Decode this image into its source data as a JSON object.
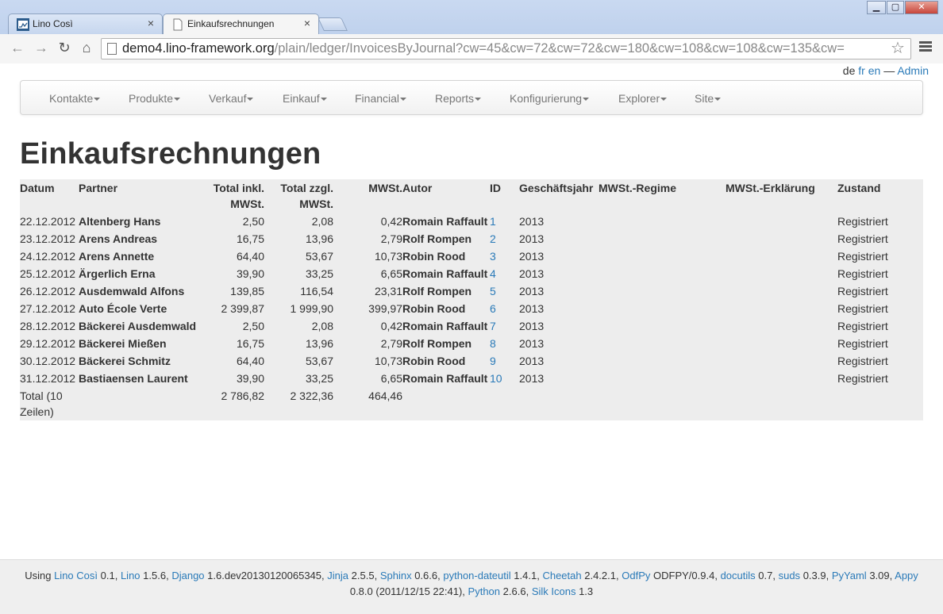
{
  "browser": {
    "tabs": [
      {
        "title": "Lino Così"
      },
      {
        "title": "Einkaufsrechnungen"
      }
    ],
    "url_host": "demo4.lino-framework.org",
    "url_path": "/plain/ledger/InvoicesByJournal?cw=45&cw=72&cw=72&cw=180&cw=108&cw=108&cw=135&cw="
  },
  "langbar": {
    "de": "de",
    "fr": "fr",
    "en": "en",
    "sep": "—",
    "admin": "Admin"
  },
  "nav": [
    "Kontakte",
    "Produkte",
    "Verkauf",
    "Einkauf",
    "Financial",
    "Reports",
    "Konfigurierung",
    "Explorer",
    "Site"
  ],
  "title": "Einkaufsrechnungen",
  "table": {
    "headers": {
      "datum": "Datum",
      "partner": "Partner",
      "total_incl": "Total inkl. MWSt.",
      "total_excl": "Total zzgl. MWSt.",
      "mwst": "MWSt.",
      "autor": "Autor",
      "id": "ID",
      "jahr": "Geschäftsjahr",
      "regime": "MWSt.-Regime",
      "erklaerung": "MWSt.-Erklärung",
      "zustand": "Zustand"
    },
    "rows": [
      {
        "datum": "22.12.2012",
        "partner": "Altenberg Hans",
        "incl": "2,50",
        "excl": "2,08",
        "mwst": "0,42",
        "autor": "Romain Raffault",
        "id": "1",
        "jahr": "2013",
        "zustand": "Registriert"
      },
      {
        "datum": "23.12.2012",
        "partner": "Arens Andreas",
        "incl": "16,75",
        "excl": "13,96",
        "mwst": "2,79",
        "autor": "Rolf Rompen",
        "id": "2",
        "jahr": "2013",
        "zustand": "Registriert"
      },
      {
        "datum": "24.12.2012",
        "partner": "Arens Annette",
        "incl": "64,40",
        "excl": "53,67",
        "mwst": "10,73",
        "autor": "Robin Rood",
        "id": "3",
        "jahr": "2013",
        "zustand": "Registriert"
      },
      {
        "datum": "25.12.2012",
        "partner": "Ärgerlich Erna",
        "incl": "39,90",
        "excl": "33,25",
        "mwst": "6,65",
        "autor": "Romain Raffault",
        "id": "4",
        "jahr": "2013",
        "zustand": "Registriert"
      },
      {
        "datum": "26.12.2012",
        "partner": "Ausdemwald Alfons",
        "incl": "139,85",
        "excl": "116,54",
        "mwst": "23,31",
        "autor": "Rolf Rompen",
        "id": "5",
        "jahr": "2013",
        "zustand": "Registriert"
      },
      {
        "datum": "27.12.2012",
        "partner": "Auto École Verte",
        "incl": "2 399,87",
        "excl": "1 999,90",
        "mwst": "399,97",
        "autor": "Robin Rood",
        "id": "6",
        "jahr": "2013",
        "zustand": "Registriert"
      },
      {
        "datum": "28.12.2012",
        "partner": "Bäckerei Ausdemwald",
        "incl": "2,50",
        "excl": "2,08",
        "mwst": "0,42",
        "autor": "Romain Raffault",
        "id": "7",
        "jahr": "2013",
        "zustand": "Registriert"
      },
      {
        "datum": "29.12.2012",
        "partner": "Bäckerei Mießen",
        "incl": "16,75",
        "excl": "13,96",
        "mwst": "2,79",
        "autor": "Rolf Rompen",
        "id": "8",
        "jahr": "2013",
        "zustand": "Registriert"
      },
      {
        "datum": "30.12.2012",
        "partner": "Bäckerei Schmitz",
        "incl": "64,40",
        "excl": "53,67",
        "mwst": "10,73",
        "autor": "Robin Rood",
        "id": "9",
        "jahr": "2013",
        "zustand": "Registriert"
      },
      {
        "datum": "31.12.2012",
        "partner": "Bastiaensen Laurent",
        "incl": "39,90",
        "excl": "33,25",
        "mwst": "6,65",
        "autor": "Romain Raffault",
        "id": "10",
        "jahr": "2013",
        "zustand": "Registriert"
      }
    ],
    "total": {
      "label": "Total (10 Zeilen)",
      "incl": "2 786,82",
      "excl": "2 322,36",
      "mwst": "464,46"
    }
  },
  "footer": {
    "prefix": "Using",
    "items": [
      {
        "name": "Lino Così",
        "version": "0.1"
      },
      {
        "name": "Lino",
        "version": "1.5.6"
      },
      {
        "name": "Django",
        "version": "1.6.dev20130120065345"
      },
      {
        "name": "Jinja",
        "version": "2.5.5"
      },
      {
        "name": "Sphinx",
        "version": "0.6.6"
      },
      {
        "name": "python-dateutil",
        "version": "1.4.1"
      },
      {
        "name": "Cheetah",
        "version": "2.4.2.1"
      },
      {
        "name": "OdfPy",
        "version": "ODFPY/0.9.4"
      },
      {
        "name": "docutils",
        "version": "0.7"
      },
      {
        "name": "suds",
        "version": "0.3.9"
      },
      {
        "name": "PyYaml",
        "version": "3.09"
      },
      {
        "name": "Appy",
        "version": "0.8.0 (2011/12/15 22:41)"
      },
      {
        "name": "Python",
        "version": "2.6.6"
      },
      {
        "name": "Silk Icons",
        "version": "1.3"
      }
    ]
  }
}
